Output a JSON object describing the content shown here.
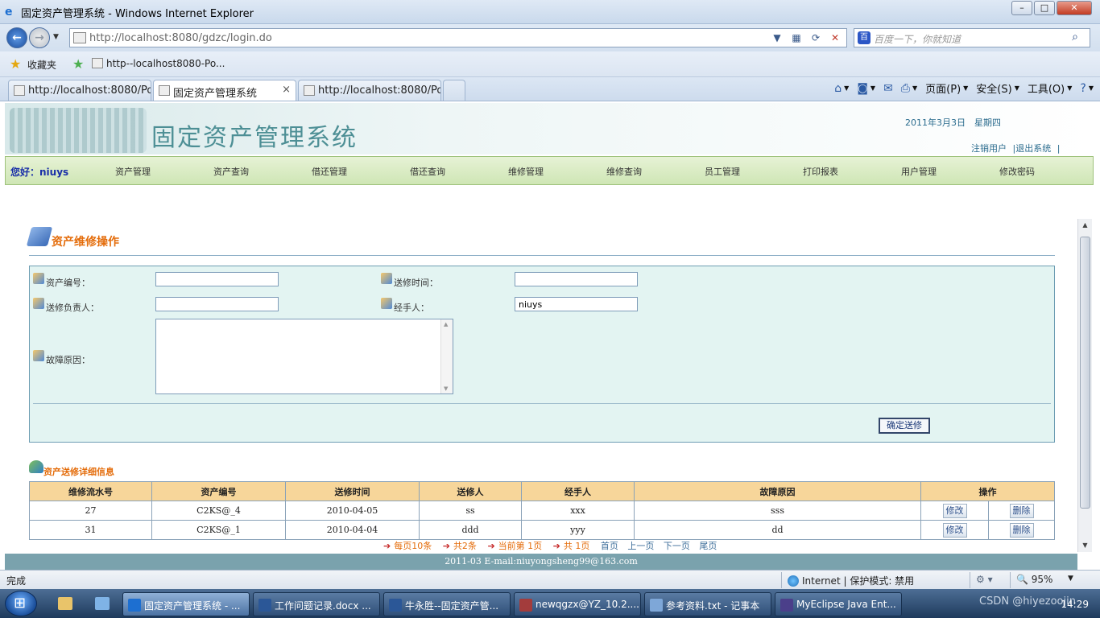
{
  "window": {
    "title": "固定资产管理系统 - Windows Internet Explorer",
    "min": "–",
    "max": "□",
    "close": "✕"
  },
  "browser": {
    "url": "http://localhost:8080/gdzc/login.do",
    "search_placeholder": "百度一下，你就知道",
    "favorites_label": "收藏夹",
    "favorite_item": "http--localhost8080-Po...",
    "tabs": [
      {
        "label": "http://localhost:8080/Po...",
        "active": false
      },
      {
        "label": "固定资产管理系统",
        "active": true
      },
      {
        "label": "http://localhost:8080/Po...",
        "active": false
      }
    ],
    "tab_close": "×",
    "commands": {
      "page": "页面(P)",
      "safety": "安全(S)",
      "tools": "工具(O)"
    }
  },
  "site": {
    "name": "固定资产管理系统",
    "date": "2011年3月3日",
    "weekday": "星期四",
    "logout": "注销用户",
    "exit": "|退出系统",
    "link_sep": "|",
    "greeting": "您好：",
    "username": "niuys",
    "menu": [
      "资产管理",
      "资产查询",
      "借还管理",
      "借还查询",
      "维修管理",
      "维修查询",
      "员工管理",
      "打印报表",
      "用户管理",
      "修改密码"
    ]
  },
  "form": {
    "title": "资产维修操作",
    "asset_no_label": "资产编号：",
    "asset_no_value": "",
    "send_time_label": "送修时间：",
    "send_time_value": "",
    "owner_label": "送修负责人：",
    "owner_value": "",
    "handler_label": "经手人：",
    "handler_value": "niuys",
    "reason_label": "故障原因：",
    "reason_value": "",
    "submit": "确定送修"
  },
  "detail": {
    "title": "资产送修详细信息",
    "columns": [
      "维修流水号",
      "资产编号",
      "送修时间",
      "送修人",
      "经手人",
      "故障原因",
      "操作"
    ],
    "rows": [
      {
        "id": "27",
        "asset": "C2KS@_4",
        "time": "2010-04-05",
        "sender": "ss",
        "handler": "xxx",
        "reason": "sss",
        "edit": "修改",
        "delete": "删除"
      },
      {
        "id": "31",
        "asset": "C2KS@_1",
        "time": "2010-04-04",
        "sender": "ddd",
        "handler": "yyy",
        "reason": "dd",
        "edit": "修改",
        "delete": "删除"
      }
    ]
  },
  "pager": {
    "per_page": "每页10条",
    "total": "共2条",
    "current": "当前第 1页",
    "pages": "共 1页",
    "first": "首页",
    "prev": "上一页",
    "next": "下一页",
    "last": "尾页"
  },
  "footer": "2011-03 E-mail:niuyongsheng99@163.com",
  "status": {
    "done": "完成",
    "zone": "Internet | 保护模式: 禁用",
    "zoom": "95%"
  },
  "taskbar": {
    "items": [
      {
        "label": "固定资产管理系统 - ...",
        "color": "#1d6fd1",
        "active": true
      },
      {
        "label": "工作问题记录.docx ...",
        "color": "#2b5797",
        "active": false
      },
      {
        "label": "牛永胜--固定资产管...",
        "color": "#2b5797",
        "active": false
      },
      {
        "label": "newqgzx@YZ_10.2....",
        "color": "#a33c3c",
        "active": false
      },
      {
        "label": "参考资料.txt - 记事本",
        "color": "#7ea7d8",
        "active": false
      },
      {
        "label": "MyEclipse Java Ent...",
        "color": "#4b3f8a",
        "active": false
      }
    ],
    "clock": "14:29",
    "watermark": "CSDN @hiyezoojin"
  }
}
